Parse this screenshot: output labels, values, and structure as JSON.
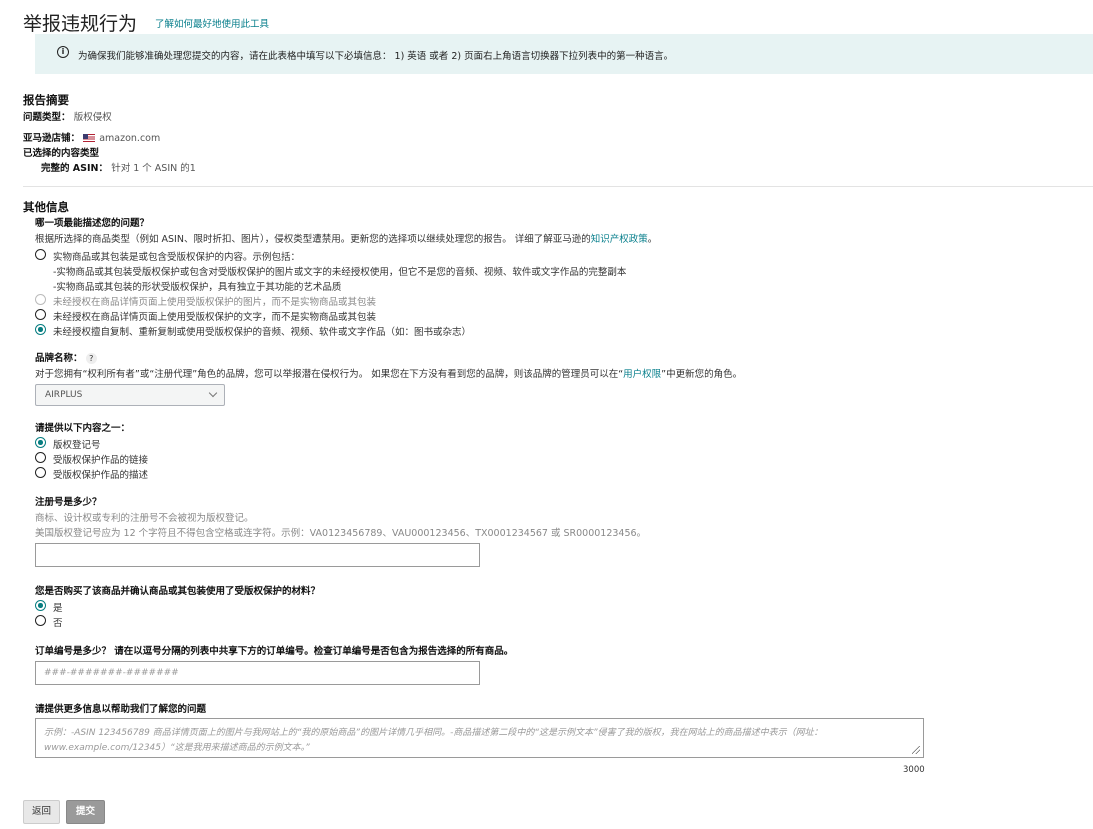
{
  "header": {
    "title": "举报违规行为",
    "help_link": "了解如何最好地使用此工具"
  },
  "banner": {
    "icon": "info-icon",
    "text": "为确保我们能够准确处理您提交的内容，请在此表格中填写以下必填信息： 1) 英语 或者 2) 页面右上角语言切换器下拉列表中的第一种语言。"
  },
  "summary": {
    "heading": "报告摘要",
    "issue_type_label": "问题类型：",
    "issue_type_value": "版权侵权",
    "store_label": "亚马逊店铺：",
    "store_value": "amazon.com",
    "content_type_label": "已选择的内容类型",
    "asin_label": "完整的 ASIN：",
    "asin_value": "针对 1 个 ASIN 的1"
  },
  "other": {
    "heading": "其他信息",
    "question": "哪一项最能描述您的问题？",
    "desc_prefix": "根据所选择的商品类型（例如 ASIN、限时折扣、图片），侵权类型遭禁用。更新您的选择项以继续处理您的报告。 详细了解亚马逊的",
    "desc_link": "知识产权政策",
    "desc_suffix": "。",
    "options": [
      {
        "line1": "实物商品或其包装是或包含受版权保护的内容。示例包括：",
        "line2": "-实物商品或其包装受版权保护或包含对受版权保护的图片或文字的未经授权使用，但它不是您的音频、视频、软件或文字作品的完整副本",
        "line3": "-实物商品或其包装的形状受版权保护，具有独立于其功能的艺术品质",
        "state": "unselected"
      },
      {
        "line1": "未经授权在商品详情页面上使用受版权保护的图片，而不是实物商品或其包装",
        "state": "disabled"
      },
      {
        "line1": "未经授权在商品详情页面上使用受版权保护的文字，而不是实物商品或其包装",
        "state": "unselected"
      },
      {
        "line1": "未经授权擅自复制、重新复制或使用受版权保护的音频、视频、软件或文字作品（如：图书或杂志）",
        "state": "selected"
      }
    ]
  },
  "brand": {
    "label": "品牌名称：",
    "help_icon": "?",
    "desc_prefix": "对于您拥有“权利所有者”或“注册代理”角色的品牌，您可以举报潜在侵权行为。 如果您在下方没有看到您的品牌，则该品牌的管理员可以在“",
    "desc_link": "用户权限",
    "desc_suffix": "”中更新您的角色。",
    "selected": "AIRPLUS"
  },
  "provide": {
    "label": "请提供以下内容之一：",
    "options": [
      {
        "label": "版权登记号",
        "state": "selected"
      },
      {
        "label": "受版权保护作品的链接",
        "state": "unselected"
      },
      {
        "label": "受版权保护作品的描述",
        "state": "unselected"
      }
    ]
  },
  "registration": {
    "label": "注册号是多少？",
    "hint1": "商标、设计权或专利的注册号不会被视为版权登记。",
    "hint2": "美国版权登记号应为 12 个字符且不得包含空格或连字符。示例：VA0123456789、VAU000123456、TX0001234567 或 SR0000123456。",
    "value": ""
  },
  "purchase": {
    "label": "您是否购买了该商品并确认商品或其包装使用了受版权保护的材料？",
    "options": [
      {
        "label": "是",
        "state": "selected"
      },
      {
        "label": "否",
        "state": "unselected"
      }
    ]
  },
  "order": {
    "label": "订单编号是多少？ 请在以逗号分隔的列表中共享下方的订单编号。检查订单编号是否包含为报告选择的所有商品。",
    "placeholder": "###-#######-#######"
  },
  "details": {
    "label": "请提供更多信息以帮助我们了解您的问题",
    "placeholder_line1": "示例：-ASIN 123456789 商品详情页面上的图片与我网站上的“我的原始商品”的图片详情几乎相同。-商品描述第二段中的“这是示例文本”侵害了我的版权，我在网站上的商品描述中表示（网址：",
    "placeholder_line2": "www.example.com/12345）“这是我用来描述商品的示例文本。”",
    "char_limit": "3000"
  },
  "buttons": {
    "back": "返回",
    "submit": "提交"
  },
  "colors": {
    "accent": "#067d80",
    "link": "#087f8c",
    "banner_bg": "#e7f3f3"
  }
}
